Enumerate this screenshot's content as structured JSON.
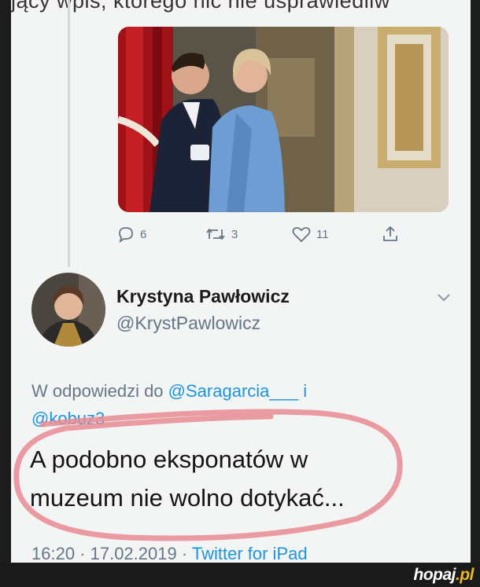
{
  "top_cut_text": "jący wpis, którego nic nie usprawiedliw",
  "actions": {
    "replies": "6",
    "retweets": "3",
    "likes": "11"
  },
  "author": {
    "name": "Krystyna Pawłowicz",
    "handle": "@KrystPawlowicz"
  },
  "reply": {
    "prefix": "W odpowiedzi do",
    "mention1": "@Saragarcia___",
    "conj": "i",
    "mention2": "@kobuz3"
  },
  "tweet": {
    "line1": "A podobno eksponatów w",
    "line2": "muzeum nie wolno dotykać..."
  },
  "meta": {
    "time": "16:20 · 17.02.2019 ·",
    "source": "Twitter for iPad"
  },
  "watermark": {
    "brand": "hopaj",
    "tld": ".pl"
  },
  "colors": {
    "mention": "#1b95e0",
    "secondary": "#657786",
    "highlight_stroke": "#e88a92"
  }
}
